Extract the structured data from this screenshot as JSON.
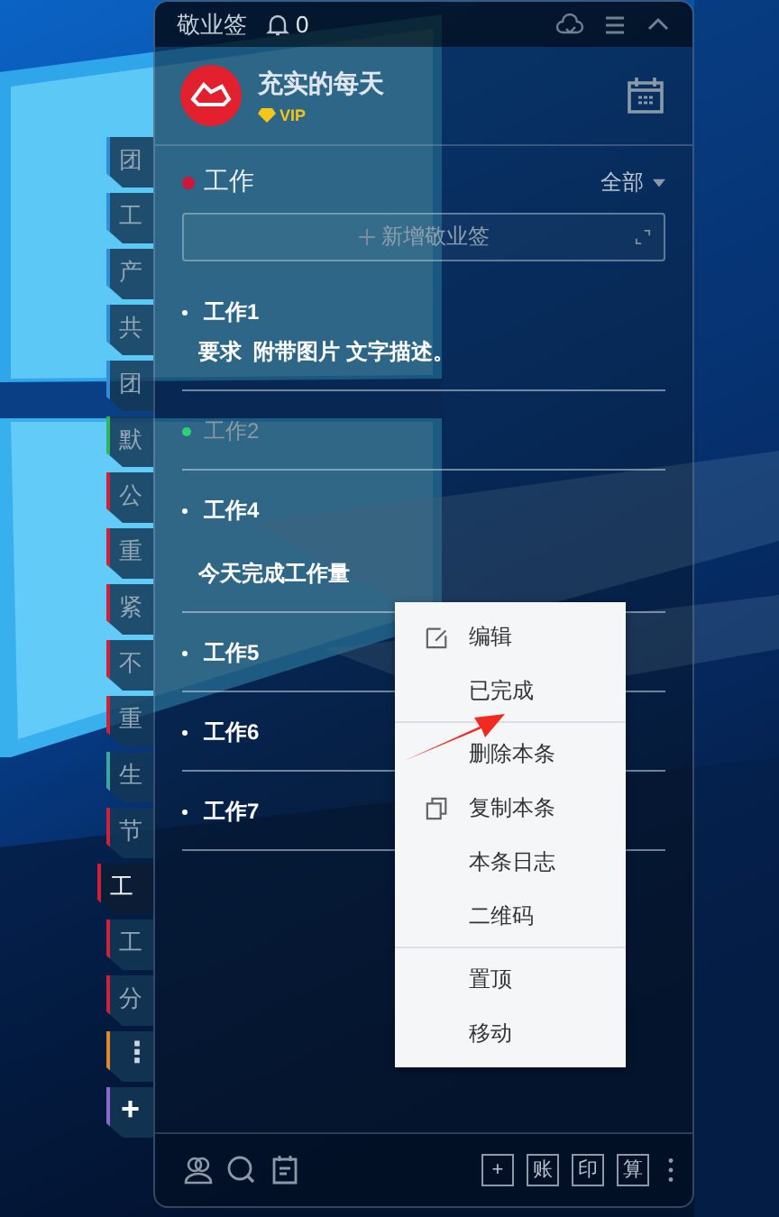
{
  "side_tabs": [
    {
      "kind": "tab",
      "label": "团",
      "color": "#2f8fd8",
      "selected": false
    },
    {
      "kind": "tab",
      "label": "工",
      "color": "#2f8fd8",
      "selected": false
    },
    {
      "kind": "tab",
      "label": "产",
      "color": "#2f8fd8",
      "selected": false
    },
    {
      "kind": "tab",
      "label": "共",
      "color": "#2f8fd8",
      "selected": false
    },
    {
      "kind": "tab",
      "label": "团",
      "color": "#2f8fd8",
      "selected": false
    },
    {
      "kind": "tab",
      "label": "默",
      "color": "#2fb85a",
      "selected": false
    },
    {
      "kind": "tab",
      "label": "公",
      "color": "#d0213c",
      "selected": false
    },
    {
      "kind": "tab",
      "label": "重",
      "color": "#d0213c",
      "selected": false
    },
    {
      "kind": "tab",
      "label": "紧",
      "color": "#d0213c",
      "selected": false
    },
    {
      "kind": "tab",
      "label": "不",
      "color": "#d0213c",
      "selected": false
    },
    {
      "kind": "tab",
      "label": "重",
      "color": "#d0213c",
      "selected": false
    },
    {
      "kind": "tab",
      "label": "生",
      "color": "#3aa7a0",
      "selected": false
    },
    {
      "kind": "tab",
      "label": "节",
      "color": "#d0213c",
      "selected": false
    },
    {
      "kind": "tab",
      "label": "工",
      "color": "#d0213c",
      "selected": true
    },
    {
      "kind": "tab",
      "label": "工",
      "color": "#d0213c",
      "selected": false
    },
    {
      "kind": "tab",
      "label": "分",
      "color": "#d0213c",
      "selected": false
    },
    {
      "kind": "more",
      "label": "⋮",
      "color": "#e08a2a",
      "selected": false
    },
    {
      "kind": "add",
      "label": "+",
      "color": "#8a6ad0",
      "selected": false
    }
  ],
  "title_bar": {
    "app_name": "敬业签",
    "notification_count": "0"
  },
  "profile": {
    "name": "充实的每天",
    "badge": "VIP"
  },
  "category": {
    "title": "工作",
    "filter": "全部"
  },
  "add_button": {
    "label": "新增敬业签"
  },
  "notes": [
    {
      "title": "工作1",
      "body": "要求  附带图片 文字描述。",
      "done": false
    },
    {
      "title": "工作2",
      "done": true
    },
    {
      "title": "工作4",
      "body": "今天完成工作量",
      "done": false
    },
    {
      "title": "工作5",
      "done": false
    },
    {
      "title": "工作6",
      "done": false
    },
    {
      "title": "工作7",
      "done": false
    }
  ],
  "context_menu": {
    "groups": [
      {
        "items": [
          {
            "kind": "edit",
            "label": "编辑"
          },
          {
            "kind": "plain",
            "label": "已完成"
          }
        ]
      },
      {
        "items": [
          {
            "kind": "plain",
            "label": "删除本条"
          },
          {
            "kind": "copy",
            "label": "复制本条"
          },
          {
            "kind": "plain",
            "label": "本条日志"
          },
          {
            "kind": "plain",
            "label": "二维码"
          }
        ]
      },
      {
        "items": [
          {
            "kind": "plain",
            "label": "置顶"
          },
          {
            "kind": "plain",
            "label": "移动"
          }
        ]
      }
    ]
  },
  "toolbar_buttons": [
    "+",
    "账",
    "印",
    "算"
  ]
}
